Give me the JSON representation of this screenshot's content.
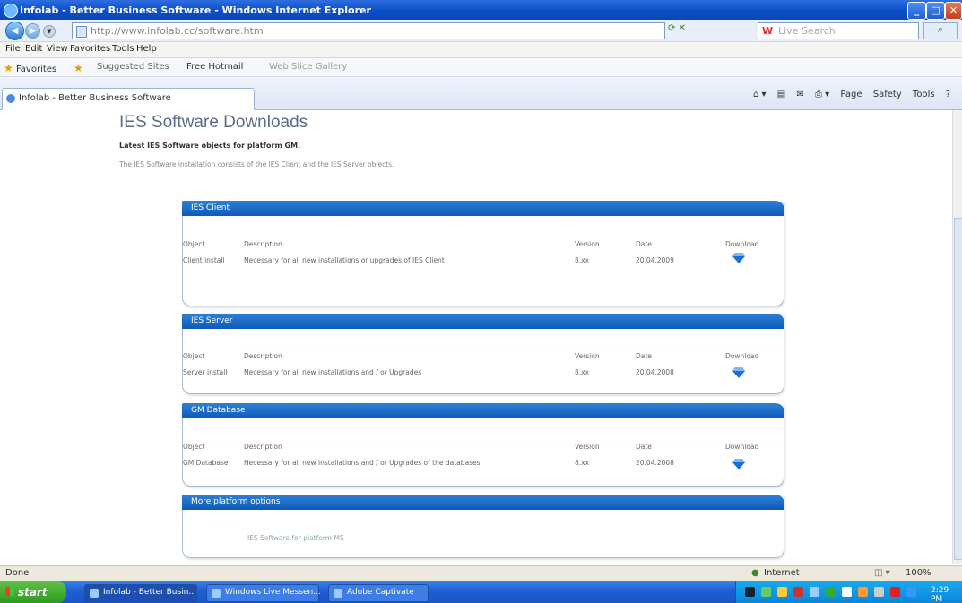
{
  "window": {
    "title": "Infolab - Better Business Software - Windows Internet Explorer",
    "buttons": {
      "minimize": "_",
      "maximize": "□",
      "close": "✕"
    }
  },
  "address": {
    "url": "http://www.infolab.cc/software.htm",
    "search_placeholder": "Live Search",
    "search_brand": "W"
  },
  "menu": [
    "File",
    "Edit",
    "View",
    "Favorites",
    "Tools",
    "Help"
  ],
  "favorites": {
    "label": "Favorites",
    "items": [
      "Suggested Sites",
      "Free Hotmail",
      "Web Slice Gallery"
    ]
  },
  "tab": {
    "label": "Infolab - Better Business Software"
  },
  "commandbar": [
    "Page",
    "Safety",
    "Tools"
  ],
  "page": {
    "title": "IES Software Downloads",
    "subheading": "Latest IES Software objects for platform GM.",
    "intro": "The IES Software installation consists of the IES Client and the IES Server objects.",
    "panels": [
      {
        "header": "IES Client",
        "columns": [
          "Object",
          "Description",
          "Version",
          "Date",
          "Download"
        ],
        "rows": [
          {
            "object": "Client install",
            "description": "Necessary for all new installations or upgrades of IES Client",
            "version": "8.xx",
            "date": "20.04.2009"
          }
        ]
      },
      {
        "header": "IES Server",
        "columns": [
          "Object",
          "Description",
          "Version",
          "Date",
          "Download"
        ],
        "rows": [
          {
            "object": "Server install",
            "description": "Necessary for all new installations and / or Upgrades",
            "version": "8.xx",
            "date": "20.04.2008"
          }
        ]
      },
      {
        "header": "GM Database",
        "columns": [
          "Object",
          "Description",
          "Version",
          "Date",
          "Download"
        ],
        "rows": [
          {
            "object": "GM Database",
            "description": "Necessary for all new installations and / or Upgrades of the databases",
            "version": "8.xx",
            "date": "20.04.2008"
          }
        ]
      },
      {
        "header": "More platform options",
        "link": "IES Software for platform MS"
      }
    ]
  },
  "status": {
    "left": "Done",
    "zone": "Internet",
    "zoom": "100%"
  },
  "taskbar": {
    "start": "start",
    "buttons": [
      "Infolab - Better Busin...",
      "Windows Live Messen...",
      "Adobe Captivate"
    ],
    "clock": "2:29 PM"
  },
  "colors": {
    "panel_header": "#0d5bb8",
    "title_bar": "#0a4ec8",
    "download_icon": "#1a6fd6"
  }
}
